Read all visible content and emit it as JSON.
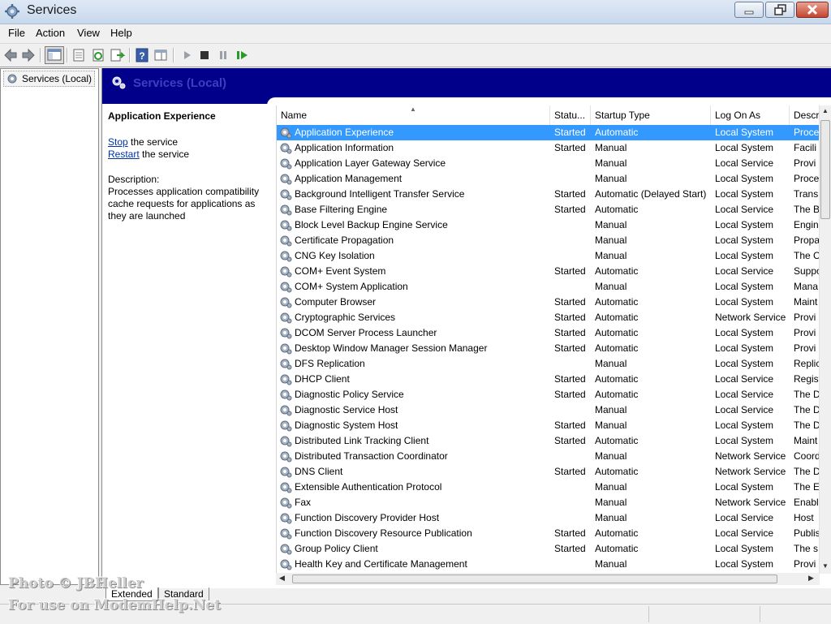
{
  "window": {
    "title": "Services"
  },
  "menu": [
    "File",
    "Action",
    "View",
    "Help"
  ],
  "tree": {
    "root_label": "Services (Local)"
  },
  "banner": {
    "title": "Services (Local)"
  },
  "detail": {
    "service_name": "Application Experience",
    "stop_link": "Stop",
    "stop_suffix": " the service",
    "restart_link": "Restart",
    "restart_suffix": " the service",
    "description_label": "Description:",
    "description": "Processes application compatibility cache requests for applications as they are launched"
  },
  "columns": [
    "Name",
    "Statu...",
    "Startup Type",
    "Log On As",
    "Descr"
  ],
  "services": [
    {
      "name": "Application Experience",
      "status": "Started",
      "startup": "Automatic",
      "logon": "Local System",
      "desc": "Proce",
      "selected": true
    },
    {
      "name": "Application Information",
      "status": "Started",
      "startup": "Manual",
      "logon": "Local System",
      "desc": "Facili"
    },
    {
      "name": "Application Layer Gateway Service",
      "status": "",
      "startup": "Manual",
      "logon": "Local Service",
      "desc": "Provi"
    },
    {
      "name": "Application Management",
      "status": "",
      "startup": "Manual",
      "logon": "Local System",
      "desc": "Proce"
    },
    {
      "name": "Background Intelligent Transfer Service",
      "status": "Started",
      "startup": "Automatic (Delayed Start)",
      "logon": "Local System",
      "desc": "Trans"
    },
    {
      "name": "Base Filtering Engine",
      "status": "Started",
      "startup": "Automatic",
      "logon": "Local Service",
      "desc": "The B"
    },
    {
      "name": "Block Level Backup Engine Service",
      "status": "",
      "startup": "Manual",
      "logon": "Local System",
      "desc": "Engin"
    },
    {
      "name": "Certificate Propagation",
      "status": "",
      "startup": "Manual",
      "logon": "Local System",
      "desc": "Propa"
    },
    {
      "name": "CNG Key Isolation",
      "status": "",
      "startup": "Manual",
      "logon": "Local System",
      "desc": "The C"
    },
    {
      "name": "COM+ Event System",
      "status": "Started",
      "startup": "Automatic",
      "logon": "Local Service",
      "desc": "Suppo"
    },
    {
      "name": "COM+ System Application",
      "status": "",
      "startup": "Manual",
      "logon": "Local System",
      "desc": "Mana"
    },
    {
      "name": "Computer Browser",
      "status": "Started",
      "startup": "Automatic",
      "logon": "Local System",
      "desc": "Maint"
    },
    {
      "name": "Cryptographic Services",
      "status": "Started",
      "startup": "Automatic",
      "logon": "Network Service",
      "desc": "Provi"
    },
    {
      "name": "DCOM Server Process Launcher",
      "status": "Started",
      "startup": "Automatic",
      "logon": "Local System",
      "desc": "Provi"
    },
    {
      "name": "Desktop Window Manager Session Manager",
      "status": "Started",
      "startup": "Automatic",
      "logon": "Local System",
      "desc": "Provi"
    },
    {
      "name": "DFS Replication",
      "status": "",
      "startup": "Manual",
      "logon": "Local System",
      "desc": "Replic"
    },
    {
      "name": "DHCP Client",
      "status": "Started",
      "startup": "Automatic",
      "logon": "Local Service",
      "desc": "Regist"
    },
    {
      "name": "Diagnostic Policy Service",
      "status": "Started",
      "startup": "Automatic",
      "logon": "Local Service",
      "desc": "The D"
    },
    {
      "name": "Diagnostic Service Host",
      "status": "",
      "startup": "Manual",
      "logon": "Local Service",
      "desc": "The D"
    },
    {
      "name": "Diagnostic System Host",
      "status": "Started",
      "startup": "Manual",
      "logon": "Local System",
      "desc": "The D"
    },
    {
      "name": "Distributed Link Tracking Client",
      "status": "Started",
      "startup": "Automatic",
      "logon": "Local System",
      "desc": "Maint"
    },
    {
      "name": "Distributed Transaction Coordinator",
      "status": "",
      "startup": "Manual",
      "logon": "Network Service",
      "desc": "Coord"
    },
    {
      "name": "DNS Client",
      "status": "Started",
      "startup": "Automatic",
      "logon": "Network Service",
      "desc": "The D"
    },
    {
      "name": "Extensible Authentication Protocol",
      "status": "",
      "startup": "Manual",
      "logon": "Local System",
      "desc": "The E"
    },
    {
      "name": "Fax",
      "status": "",
      "startup": "Manual",
      "logon": "Network Service",
      "desc": "Enabl"
    },
    {
      "name": "Function Discovery Provider Host",
      "status": "",
      "startup": "Manual",
      "logon": "Local Service",
      "desc": "Host"
    },
    {
      "name": "Function Discovery Resource Publication",
      "status": "Started",
      "startup": "Automatic",
      "logon": "Local Service",
      "desc": "Publis"
    },
    {
      "name": "Group Policy Client",
      "status": "Started",
      "startup": "Automatic",
      "logon": "Local System",
      "desc": "The s"
    },
    {
      "name": "Health Key and Certificate Management",
      "status": "",
      "startup": "Manual",
      "logon": "Local System",
      "desc": "Provi"
    }
  ],
  "tabs": [
    "Extended",
    "Standard"
  ],
  "watermark": [
    "Photo © JBHeller",
    "For use on ModemHelp.Net"
  ],
  "colors": {
    "banner": "#00008b",
    "selection": "#3399ff",
    "link": "#0033aa"
  }
}
